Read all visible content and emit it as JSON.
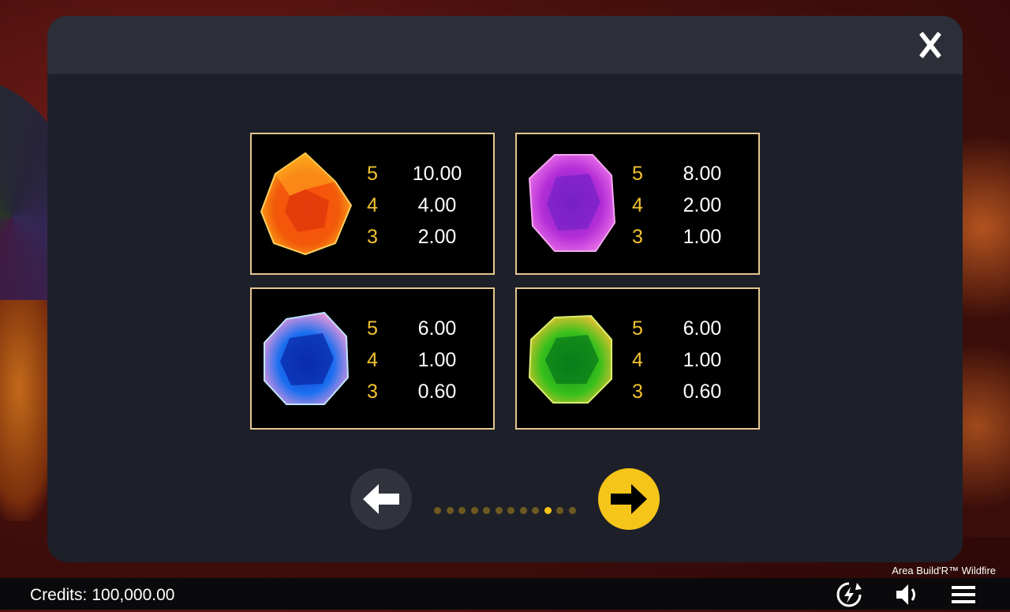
{
  "modal": {
    "close_label": "X",
    "paytable": [
      {
        "gem": "orange-gem",
        "color": "#f26a12",
        "payouts": [
          {
            "count": "5",
            "value": "10.00"
          },
          {
            "count": "4",
            "value": "4.00"
          },
          {
            "count": "3",
            "value": "2.00"
          }
        ]
      },
      {
        "gem": "purple-gem",
        "color": "#b52fd8",
        "payouts": [
          {
            "count": "5",
            "value": "8.00"
          },
          {
            "count": "4",
            "value": "2.00"
          },
          {
            "count": "3",
            "value": "1.00"
          }
        ]
      },
      {
        "gem": "blue-gem",
        "color": "#1b6ff0",
        "payouts": [
          {
            "count": "5",
            "value": "6.00"
          },
          {
            "count": "4",
            "value": "1.00"
          },
          {
            "count": "3",
            "value": "0.60"
          }
        ]
      },
      {
        "gem": "green-gem",
        "color": "#38c01c",
        "payouts": [
          {
            "count": "5",
            "value": "6.00"
          },
          {
            "count": "4",
            "value": "1.00"
          },
          {
            "count": "3",
            "value": "0.60"
          }
        ]
      }
    ],
    "pagination": {
      "total_pages": 12,
      "current_page": 10
    }
  },
  "footer": {
    "game_title": "Area Build'R™ Wildfire",
    "credits_label": "Credits:",
    "credits_value": "100,000.00",
    "icons": [
      "turbo-icon",
      "sound-icon",
      "menu-icon"
    ]
  },
  "colors": {
    "accent": "#f6c519",
    "card_border": "#e4c690",
    "count_color": "#f2c230"
  }
}
